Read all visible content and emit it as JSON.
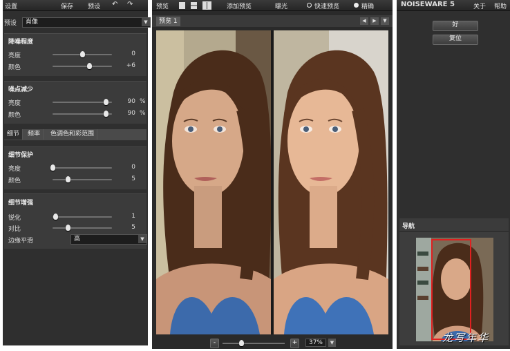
{
  "left_toolbar": {
    "settings_label": "设置",
    "save_label": "保存",
    "preset_label": "预设"
  },
  "preset": {
    "label": "预设",
    "value": "肖像"
  },
  "noise_level": {
    "title": "降噪程度",
    "rows": [
      {
        "label": "亮度",
        "value": "0"
      },
      {
        "label": "颜色",
        "value": "+6"
      }
    ],
    "levels": [
      0.5,
      0.62
    ]
  },
  "noise_reduction": {
    "title": "噪点减少",
    "rows": [
      {
        "label": "亮度",
        "value": "90",
        "unit": "%"
      },
      {
        "label": "颜色",
        "value": "90",
        "unit": "%"
      }
    ],
    "levels": [
      0.9,
      0.9
    ]
  },
  "tabs": [
    "细节",
    "频率",
    "色调色和彩范围"
  ],
  "detail_protection": {
    "title": "细节保护",
    "rows": [
      {
        "label": "亮度",
        "value": "0"
      },
      {
        "label": "颜色",
        "value": "5"
      }
    ],
    "levels": [
      0.0,
      0.25
    ]
  },
  "detail_enhance": {
    "title": "细节增强",
    "rows": [
      {
        "label": "锐化",
        "value": "1"
      },
      {
        "label": "对比",
        "value": "5"
      }
    ],
    "levels": [
      0.05,
      0.25
    ],
    "edge_label": "边缘平滑",
    "edge_value": "高"
  },
  "center_toolbar": {
    "preview_label": "预览",
    "add_preview_label": "添加预览",
    "exposure_label": "曝光",
    "fast_preview_label": "快速预览",
    "precise_label": "精确"
  },
  "preview_tab": "预览 1",
  "zoom": {
    "minus": "-",
    "plus": "+",
    "value": "37%",
    "level": 0.3
  },
  "right": {
    "brand": "NOISEWARE 5",
    "about_label": "关于",
    "help_label": "帮助",
    "ok_label": "好",
    "reset_label": "复位",
    "nav_label": "导航"
  },
  "watermark": "龙写年华",
  "colors": {
    "panel_bg": "#2f2f2f",
    "section_bg": "#3b3b3b",
    "nav_box": "#e02020"
  }
}
